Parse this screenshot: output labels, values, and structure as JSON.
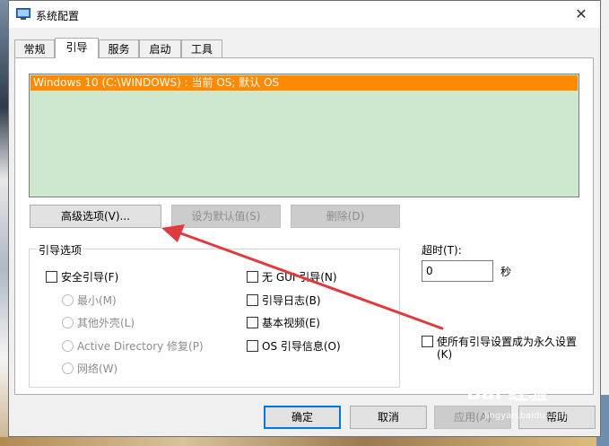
{
  "window": {
    "title": "系统配置",
    "close": "✕"
  },
  "tabs": [
    {
      "label": "常规",
      "active": false
    },
    {
      "label": "引导",
      "active": true
    },
    {
      "label": "服务",
      "active": false
    },
    {
      "label": "启动",
      "active": false
    },
    {
      "label": "工具",
      "active": false
    }
  ],
  "os_list": {
    "items": [
      "Windows 10 (C:\\WINDOWS) : 当前 OS; 默认 OS"
    ],
    "selected_index": 0
  },
  "buttons": {
    "advanced": "高级选项(V)...",
    "set_default": "设为默认值(S)",
    "delete": "删除(D)"
  },
  "boot_options": {
    "title": "引导选项",
    "safe_boot": "安全引导(F)",
    "minimal": "最小(M)",
    "alt_shell": "其他外壳(L)",
    "ad_repair": "Active Directory 修复(P)",
    "network": "网络(W)",
    "no_gui": "无 GUI 引导(N)",
    "boot_log": "引导日志(B)",
    "base_video": "基本视频(E)",
    "os_boot_info": "OS 引导信息(O)"
  },
  "timeout": {
    "label": "超时(T):",
    "value": "0",
    "unit": "秒"
  },
  "permanent": {
    "line1": "使所有引导设置成为永久设置",
    "line2": "(K)"
  },
  "footer": {
    "ok": "确定",
    "cancel": "取消",
    "apply": "应用(A)",
    "help": "帮助"
  },
  "watermark": {
    "brand": "Bai 经验",
    "url": "jingyan.baidu.com"
  },
  "colors": {
    "selection": "#ff8a00",
    "list_background": "#cde8cf",
    "arrow": "#e0393e",
    "accent": "#0078d7"
  }
}
